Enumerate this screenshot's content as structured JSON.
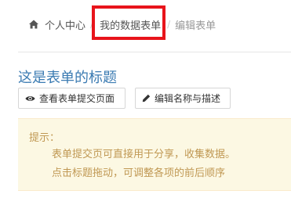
{
  "breadcrumb": {
    "home": "个人中心",
    "my_forms": "我的数据表单",
    "current": "编辑表单"
  },
  "form": {
    "title": "这是表单的标题"
  },
  "actions": {
    "view_submit_page": "查看表单提交页面",
    "edit_name_desc": "编辑名称与描述"
  },
  "tip": {
    "label": "提示：",
    "line1": "表单提交页可直接用于分享，收集数据。",
    "line2": "点击标题拖动，可调整各项的前后顺序"
  },
  "colors": {
    "highlight": "#e8141b",
    "title": "#3b7bb2",
    "tip_text": "#c09853",
    "tip_bg": "#fcf8e3"
  }
}
